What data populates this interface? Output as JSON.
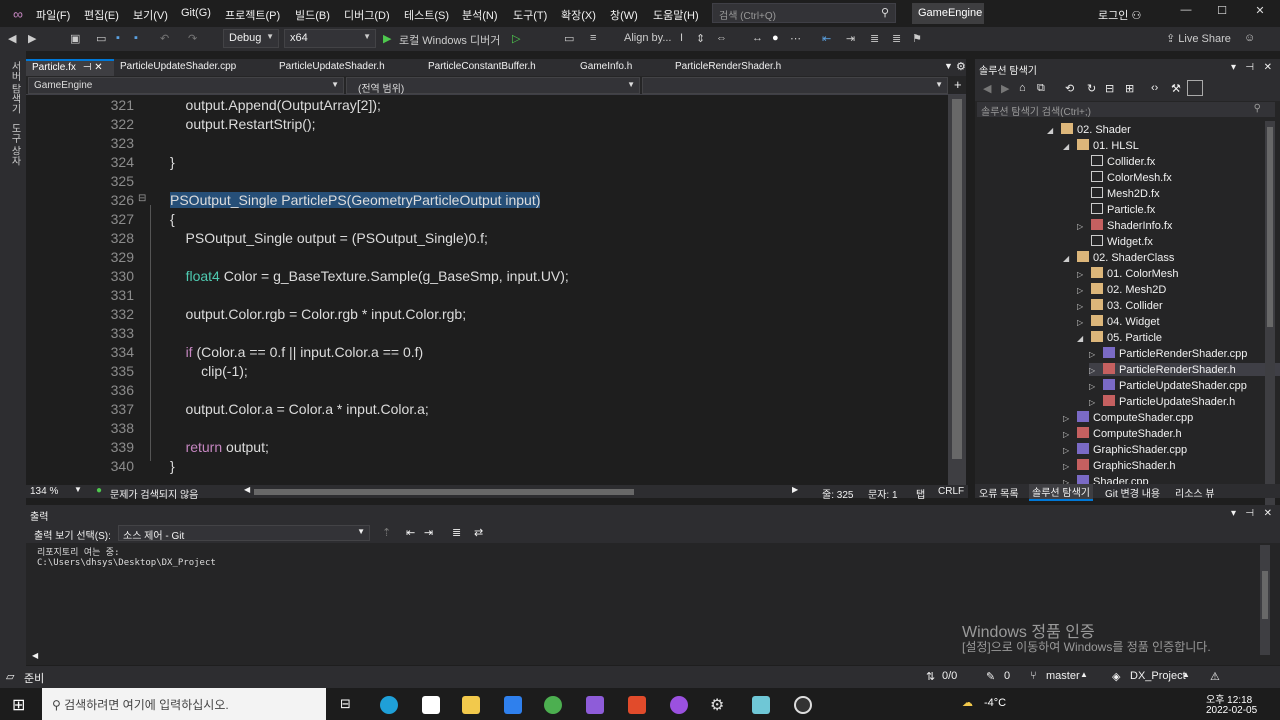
{
  "menu": {
    "items": [
      "파일(F)",
      "편집(E)",
      "보기(V)",
      "Git(G)",
      "프로젝트(P)",
      "빌드(B)",
      "디버그(D)",
      "테스트(S)",
      "분석(N)",
      "도구(T)",
      "확장(X)",
      "창(W)",
      "도움말(H)"
    ],
    "search_placeholder": "검색 (Ctrl+Q)",
    "solution_name": "GameEngine",
    "login": "로그인"
  },
  "toolbar": {
    "config": "Debug",
    "platform": "x64",
    "run_label": "로컬 Windows 디버거",
    "align_label": "Align by...",
    "live_share": "Live Share"
  },
  "left_rail": [
    "서버 탐색기",
    "도구 상자"
  ],
  "tabs": [
    "Particle.fx",
    "ParticleUpdateShader.cpp",
    "ParticleUpdateShader.h",
    "ParticleConstantBuffer.h",
    "GameInfo.h",
    "ParticleRenderShader.h"
  ],
  "nav": {
    "project": "GameEngine",
    "scope": "(전역 범위)"
  },
  "editor": {
    "lines": [
      {
        "n": "321",
        "t": "    output.Append(OutputArray[2]);"
      },
      {
        "n": "322",
        "t": "    output.RestartStrip();"
      },
      {
        "n": "323",
        "t": ""
      },
      {
        "n": "324",
        "t": "}"
      },
      {
        "n": "325",
        "t": ""
      },
      {
        "n": "326",
        "t": "PSOutput_Single ParticlePS(GeometryParticleOutput input)"
      },
      {
        "n": "327",
        "t": "{"
      },
      {
        "n": "328",
        "t": "    PSOutput_Single output = (PSOutput_Single)0.f;"
      },
      {
        "n": "329",
        "t": ""
      },
      {
        "n": "330",
        "t": "    float4 Color = g_BaseTexture.Sample(g_BaseSmp, input.UV);"
      },
      {
        "n": "331",
        "t": ""
      },
      {
        "n": "332",
        "t": "    output.Color.rgb = Color.rgb * input.Color.rgb;"
      },
      {
        "n": "333",
        "t": ""
      },
      {
        "n": "334",
        "t": "    if (Color.a == 0.f || input.Color.a == 0.f)"
      },
      {
        "n": "335",
        "t": "        clip(-1);"
      },
      {
        "n": "336",
        "t": ""
      },
      {
        "n": "337",
        "t": "    output.Color.a = Color.a * input.Color.a;"
      },
      {
        "n": "338",
        "t": ""
      },
      {
        "n": "339",
        "t": "    return output;"
      },
      {
        "n": "340",
        "t": "}"
      }
    ],
    "zoom": "134 %",
    "issues": "문제가 검색되지 않음",
    "line_info": "줄: 325",
    "col_info": "문자: 1",
    "tab_mode": "탭",
    "eol": "CRLF"
  },
  "solution": {
    "title": "솔루션 탐색기",
    "search_placeholder": "솔루션 탐색기 검색(Ctrl+;)",
    "tree": [
      {
        "label": "02. Shader",
        "indent": 0,
        "kind": "folder"
      },
      {
        "label": "01. HLSL",
        "indent": 1,
        "kind": "folder"
      },
      {
        "label": "Collider.fx",
        "indent": 2,
        "kind": "file"
      },
      {
        "label": "ColorMesh.fx",
        "indent": 2,
        "kind": "file"
      },
      {
        "label": "Mesh2D.fx",
        "indent": 2,
        "kind": "file"
      },
      {
        "label": "Particle.fx",
        "indent": 2,
        "kind": "file"
      },
      {
        "label": "ShaderInfo.fx",
        "indent": 2,
        "kind": "hfile"
      },
      {
        "label": "Widget.fx",
        "indent": 2,
        "kind": "file"
      },
      {
        "label": "02. ShaderClass",
        "indent": 1,
        "kind": "folder"
      },
      {
        "label": "01. ColorMesh",
        "indent": 2,
        "kind": "folder"
      },
      {
        "label": "02. Mesh2D",
        "indent": 2,
        "kind": "folder"
      },
      {
        "label": "03. Collider",
        "indent": 2,
        "kind": "folder"
      },
      {
        "label": "04. Widget",
        "indent": 2,
        "kind": "folder"
      },
      {
        "label": "05. Particle",
        "indent": 2,
        "kind": "folder"
      },
      {
        "label": "ParticleRenderShader.cpp",
        "indent": 3,
        "kind": "cpp"
      },
      {
        "label": "ParticleRenderShader.h",
        "indent": 3,
        "kind": "hfile"
      },
      {
        "label": "ParticleUpdateShader.cpp",
        "indent": 3,
        "kind": "cpp"
      },
      {
        "label": "ParticleUpdateShader.h",
        "indent": 3,
        "kind": "hfile"
      },
      {
        "label": "ComputeShader.cpp",
        "indent": 1,
        "kind": "cpp"
      },
      {
        "label": "ComputeShader.h",
        "indent": 1,
        "kind": "hfile"
      },
      {
        "label": "GraphicShader.cpp",
        "indent": 1,
        "kind": "cpp"
      },
      {
        "label": "GraphicShader.h",
        "indent": 1,
        "kind": "hfile"
      },
      {
        "label": "Shader.cpp",
        "indent": 1,
        "kind": "cpp"
      }
    ],
    "bottom_tabs": [
      "오류 목록",
      "솔루션 탐색기",
      "Git 변경 내용",
      "리소스 뷰"
    ]
  },
  "output": {
    "title": "출력",
    "source_label": "출력 보기 선택(S):",
    "source_value": "소스 제어 - Git",
    "lines": [
      "리포지토리 여는 중:",
      "C:\\Users\\dhsys\\Desktop\\DX_Project"
    ]
  },
  "watermark": {
    "title": "Windows 정품 인증",
    "sub": "[설정]으로 이동하여 Windows를 정품 인증합니다."
  },
  "status": {
    "ready": "준비",
    "changes": "0/0",
    "pending": "0",
    "branch": "master",
    "repo": "DX_Project"
  },
  "taskbar": {
    "search": "검색하려면 여기에 입력하십시오.",
    "temp": "-4°C",
    "time": "오후 12:18",
    "date": "2022-02-05"
  }
}
